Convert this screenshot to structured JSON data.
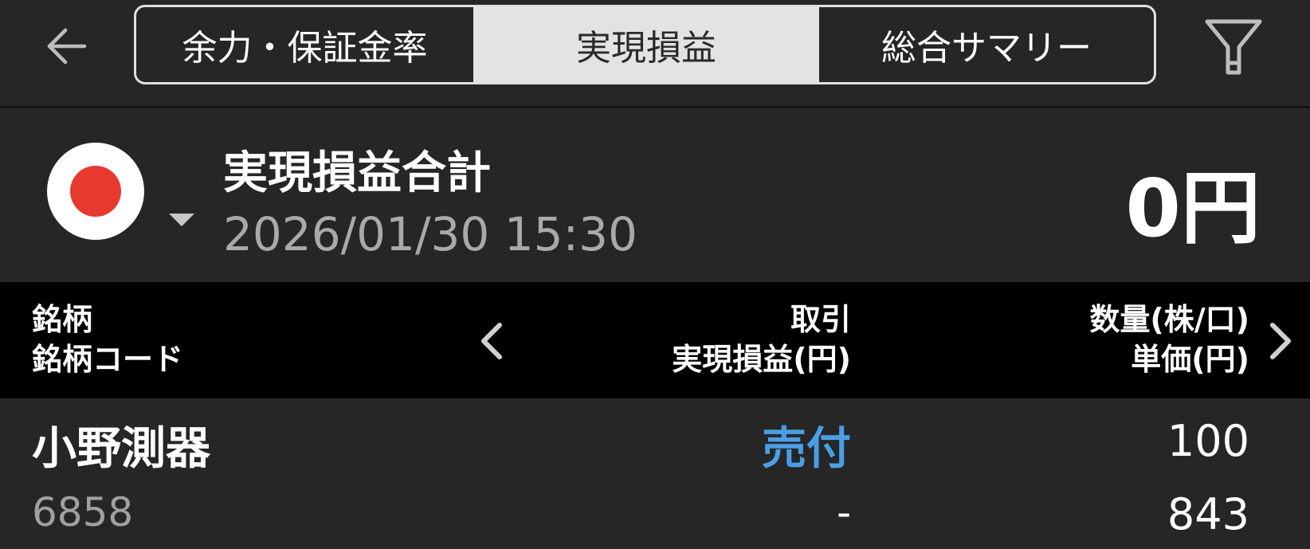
{
  "header": {
    "tabs": [
      {
        "label": "余力・保証金率"
      },
      {
        "label": "実現損益"
      },
      {
        "label": "総合サマリー"
      }
    ],
    "active_tab": "実現損益"
  },
  "summary": {
    "currency": "円",
    "title": "実現損益合計",
    "datetime": "2026/01/30  15:30",
    "total": "0円"
  },
  "columns": {
    "left": [
      "銘柄",
      "銘柄コード"
    ],
    "middle": [
      "取引",
      "実現損益(円)"
    ],
    "right": [
      "数量(株/口)",
      "単価(円)"
    ]
  },
  "rows": [
    {
      "name": "小野測器",
      "code": "6858",
      "trade": "売付",
      "realized_pl": "-",
      "quantity": "100",
      "unit_price": "843"
    }
  ],
  "colors": {
    "background": "#262626",
    "header_bar": "#000000",
    "active_tab_bg": "#e3e3e3",
    "trade_sell": "#4a9ee6",
    "flag_red": "#e8392f"
  },
  "icons": {
    "back": "back-arrow-icon",
    "filter": "filter-icon",
    "prev": "chevron-left-icon",
    "next": "chevron-right-icon",
    "currency": "japan-flag-icon"
  }
}
